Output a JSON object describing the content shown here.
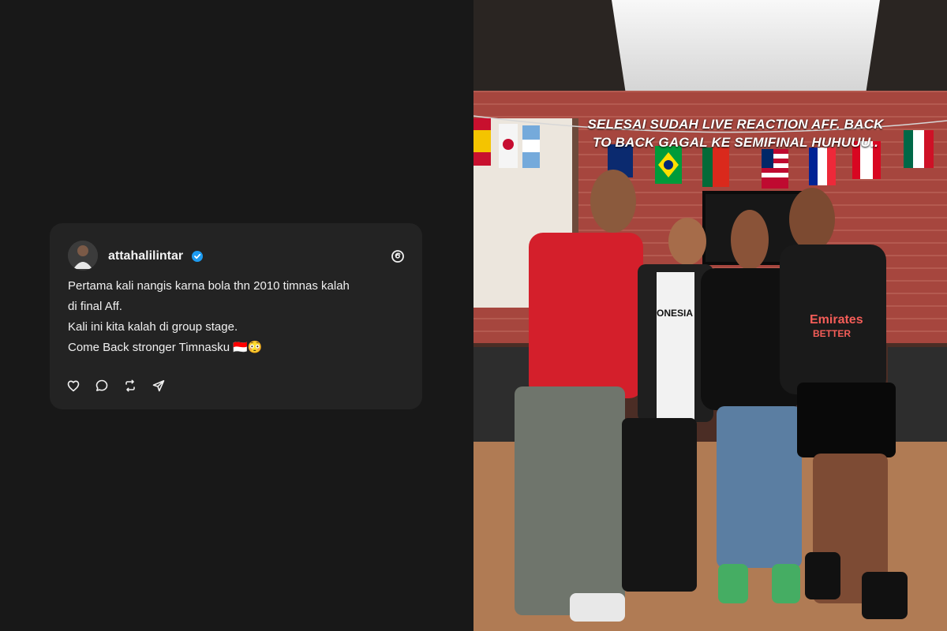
{
  "post": {
    "username": "attahalilintar",
    "lines": [
      "Pertama kali nangis karna bola thn 2010 timnas kalah",
      "di final Aff.",
      "Kali ini kita kalah di group stage.",
      "Come Back stronger Timnasku 🇮🇩😳"
    ]
  },
  "photo": {
    "caption_line1": "SELESAI SUDAH LIVE REACTION AFF. BACK",
    "caption_line2": "TO BACK GAGAL KE SEMIFINAL HUHUUU..",
    "shirt_texts": [
      "ONESIA",
      "Emirates",
      "BETTER"
    ]
  },
  "colors": {
    "background": "#181818",
    "card": "#232323",
    "text": "#f0f0f0",
    "verified": "#1d9bf0"
  },
  "icons": [
    "heart-icon",
    "comment-icon",
    "repost-icon",
    "share-icon",
    "threads-icon",
    "verified-badge-icon"
  ]
}
